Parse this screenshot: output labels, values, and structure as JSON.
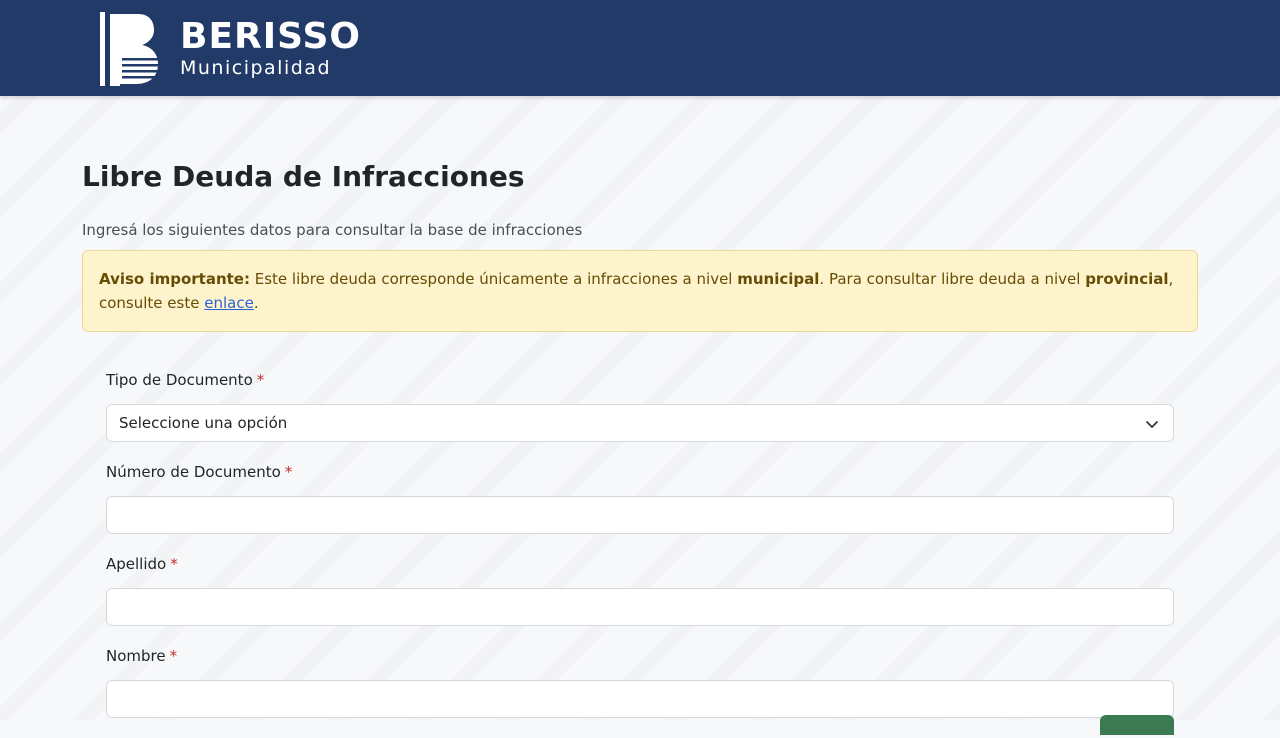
{
  "header": {
    "brand_name": "BERISSO",
    "brand_sub": "Municipalidad",
    "colors": {
      "bar": "#213a68",
      "text": "#ffffff"
    }
  },
  "page": {
    "title": "Libre Deuda de Infracciones",
    "intro": "Ingresá los siguientes datos para consultar la base de infracciones"
  },
  "alert": {
    "lead": "Aviso importante:",
    "text1": " Este libre deuda corresponde únicamente a infracciones a nivel ",
    "bold1": "municipal",
    "text2": ". Para consultar libre deuda a nivel ",
    "bold2": "provincial",
    "text3": ", consulte este ",
    "link": "enlace",
    "text4": "."
  },
  "form": {
    "required_mark": "*",
    "tipo_documento": {
      "label": "Tipo de Documento",
      "selected": "Seleccione una opción"
    },
    "numero_documento": {
      "label": "Número de Documento",
      "value": ""
    },
    "apellido": {
      "label": "Apellido",
      "value": ""
    },
    "nombre": {
      "label": "Nombre",
      "value": ""
    }
  }
}
